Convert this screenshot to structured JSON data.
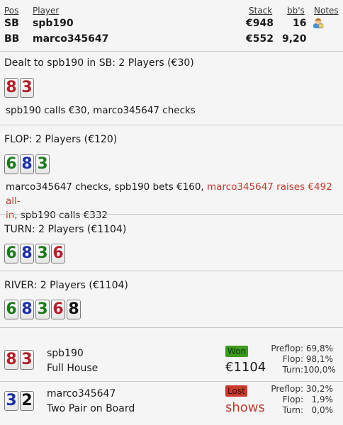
{
  "header": {
    "pos": "Pos",
    "player": "Player",
    "stack": "Stack",
    "bbs": "bb's",
    "notes": "Notes"
  },
  "players": [
    {
      "pos": "SB",
      "name": "spb190",
      "stack": "€948",
      "bbs": "16",
      "notes_icon": "user-note-icon"
    },
    {
      "pos": "BB",
      "name": "marco345647",
      "stack": "€552",
      "bbs": "9,20"
    }
  ],
  "preflop": {
    "title": "Dealt to spb190 in SB: 2 Players (€30)",
    "cards": [
      "8",
      "3"
    ],
    "action": "spb190 calls €30, marco345647 checks"
  },
  "flop": {
    "title": "FLOP: 2 Players (€120)",
    "cards": [
      "6",
      "8",
      "3"
    ],
    "action_normal_1": "marco345647 checks, spb190 bets €160, ",
    "action_raise_1": "marco345647 raises €492 all-",
    "action_raise_2": "in,",
    "action_normal_2": " spb190 calls €332"
  },
  "turn": {
    "title": "TURN: 2 Players (€1104)",
    "cards": [
      "6",
      "8",
      "3",
      "6"
    ]
  },
  "river": {
    "title": "RIVER: 2 Players (€1104)",
    "cards": [
      "6",
      "8",
      "3",
      "6",
      "8"
    ]
  },
  "results": [
    {
      "cards": [
        "8",
        "3"
      ],
      "name": "spb190",
      "hand": "Full House",
      "badge": "Won",
      "amount": "€1104",
      "preflop_label": "Preflop:",
      "preflop": "69,8%",
      "flop_label": "Flop:",
      "flop": "98,1%",
      "turn_label": "Turn:",
      "turn": "100,0%"
    },
    {
      "cards": [
        "3",
        "2"
      ],
      "name": "marco345647",
      "hand": "Two Pair on Board",
      "badge": "Lost",
      "amount": "shows",
      "preflop_label": "Preflop:",
      "preflop": "30,2%",
      "flop_label": "Flop:",
      "flop": "1,9%",
      "turn_label": "Turn:",
      "turn": "0,0%"
    }
  ],
  "colors": {
    "red_card": "#b3202a",
    "green_card": "#1f7a1f",
    "blue_card": "#1d2fa8",
    "black_card": "#111111"
  }
}
